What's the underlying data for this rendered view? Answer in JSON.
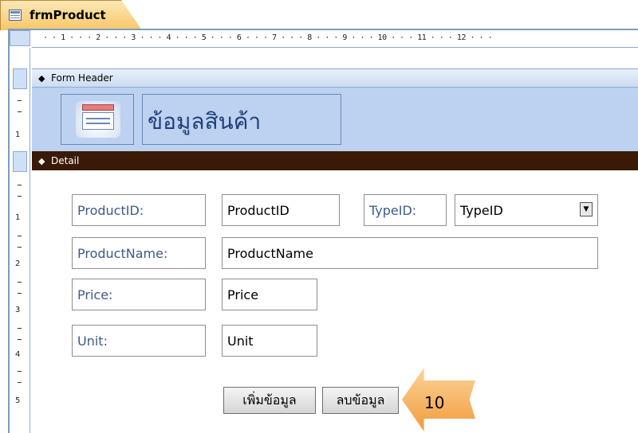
{
  "tab": {
    "title": "frmProduct",
    "icon": "form-icon"
  },
  "ruler": {
    "horizontal": "· · 1 · · · 2 · · · 3 · · · 4 · · · 5 · · · 6 · · · 7 · · · 8 · · · 9 · · · 10 · · · 11 · · · 12 · · ·",
    "vertical_numbers": [
      "1",
      "1",
      "2",
      "3",
      "4",
      "5"
    ]
  },
  "sections": {
    "header": "Form Header",
    "detail": "Detail"
  },
  "header": {
    "title": "ข้อมูลสินค้า",
    "logo": "form-logo-icon"
  },
  "fields": [
    {
      "label": "ProductID:",
      "control": "ProductID"
    },
    {
      "label": "TypeID:",
      "control": "TypeID"
    },
    {
      "label": "ProductName:",
      "control": "ProductName"
    },
    {
      "label": "Price:",
      "control": "Price"
    },
    {
      "label": "Unit:",
      "control": "Unit"
    }
  ],
  "buttons": {
    "add": "เพิ่มข้อมูล",
    "delete": "ลบข้อมูล"
  },
  "callout": {
    "number": "10"
  },
  "colors": {
    "tab_bg": "#f6c768",
    "header_band": "#bcd2f0",
    "detail_bar": "#3a1a07",
    "label_text": "#3e5a8a",
    "callout": "#f29b3b"
  }
}
